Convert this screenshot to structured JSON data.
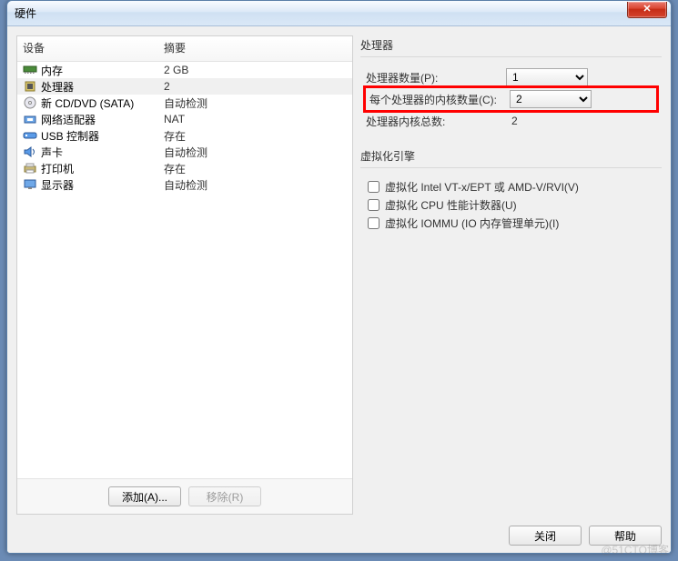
{
  "window": {
    "title": "硬件"
  },
  "deviceList": {
    "headers": {
      "device": "设备",
      "summary": "摘要"
    },
    "rows": [
      {
        "icon": "memory-icon",
        "name": "内存",
        "summary": "2 GB",
        "selected": false
      },
      {
        "icon": "cpu-icon",
        "name": "处理器",
        "summary": "2",
        "selected": true
      },
      {
        "icon": "cd-icon",
        "name": "新 CD/DVD (SATA)",
        "summary": "自动检测",
        "selected": false
      },
      {
        "icon": "network-icon",
        "name": "网络适配器",
        "summary": "NAT",
        "selected": false
      },
      {
        "icon": "usb-icon",
        "name": "USB 控制器",
        "summary": "存在",
        "selected": false
      },
      {
        "icon": "sound-icon",
        "name": "声卡",
        "summary": "自动检测",
        "selected": false
      },
      {
        "icon": "printer-icon",
        "name": "打印机",
        "summary": "存在",
        "selected": false
      },
      {
        "icon": "display-icon",
        "name": "显示器",
        "summary": "自动检测",
        "selected": false
      }
    ],
    "buttons": {
      "add": "添加(A)...",
      "remove": "移除(R)"
    }
  },
  "processorPanel": {
    "groupTitle": "处理器",
    "numProcessorsLabel": "处理器数量(P):",
    "numProcessorsValue": "1",
    "coresPerProcessorLabel": "每个处理器的内核数量(C):",
    "coresPerProcessorValue": "2",
    "totalCoresLabel": "处理器内核总数:",
    "totalCoresValue": "2"
  },
  "virtEngine": {
    "groupTitle": "虚拟化引擎",
    "opts": [
      {
        "label": "虚拟化 Intel VT-x/EPT 或 AMD-V/RVI(V)",
        "checked": false
      },
      {
        "label": "虚拟化 CPU 性能计数器(U)",
        "checked": false
      },
      {
        "label": "虚拟化 IOMMU (IO 内存管理单元)(I)",
        "checked": false
      }
    ]
  },
  "footer": {
    "close": "关闭",
    "help": "帮助"
  },
  "watermark": "@51CTO博客"
}
